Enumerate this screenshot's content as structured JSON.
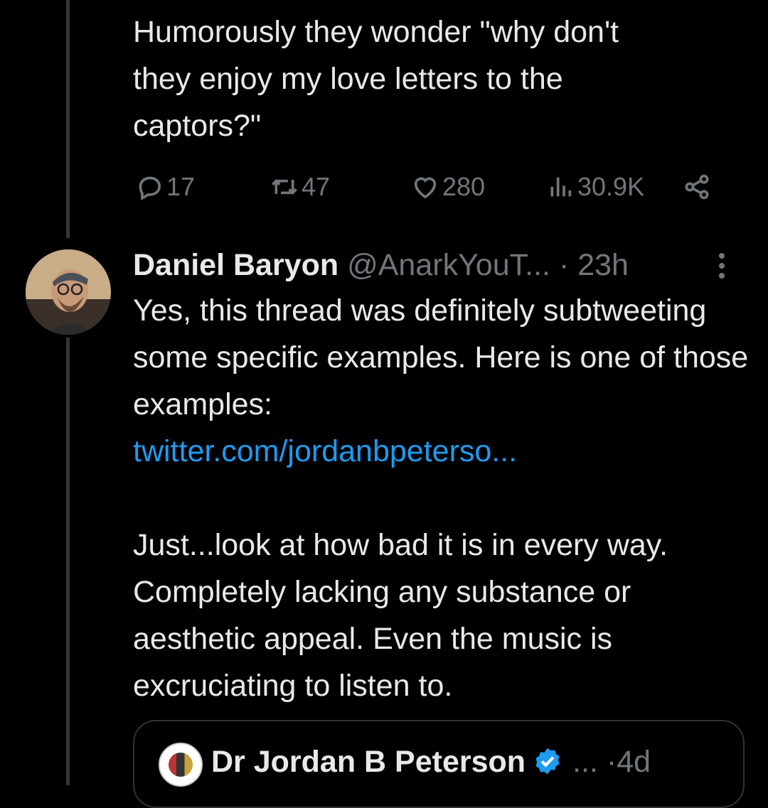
{
  "previous_tweet": {
    "text": "Humorously they wonder \"why don't\nthey enjoy my love letters to the\ncaptors?\"",
    "actions": {
      "replies": "17",
      "retweets": "47",
      "likes": "280",
      "views": "30.9K"
    }
  },
  "reply_tweet": {
    "author_name": "Daniel Baryon",
    "handle": "@AnarkYouT...",
    "separator": "·",
    "time": "23h",
    "paragraph1": "Yes, this thread was definitely subtweeting some specific examples. Here is one of those examples:",
    "link": "twitter.com/jordanbpeterso...",
    "paragraph2": "Just...look at how bad it is in every way. Completely lacking any substance or aesthetic appeal. Even the music is excruciating to listen to."
  },
  "quoted_tweet": {
    "author_name": "Dr Jordan B Peterson",
    "ellipsis": "...",
    "separator": "·",
    "time": "4d"
  },
  "colors": {
    "background": "#000000",
    "text": "#e7e9ea",
    "muted": "#71767b",
    "link": "#1d9bf0",
    "verified": "#1d9bf0"
  }
}
